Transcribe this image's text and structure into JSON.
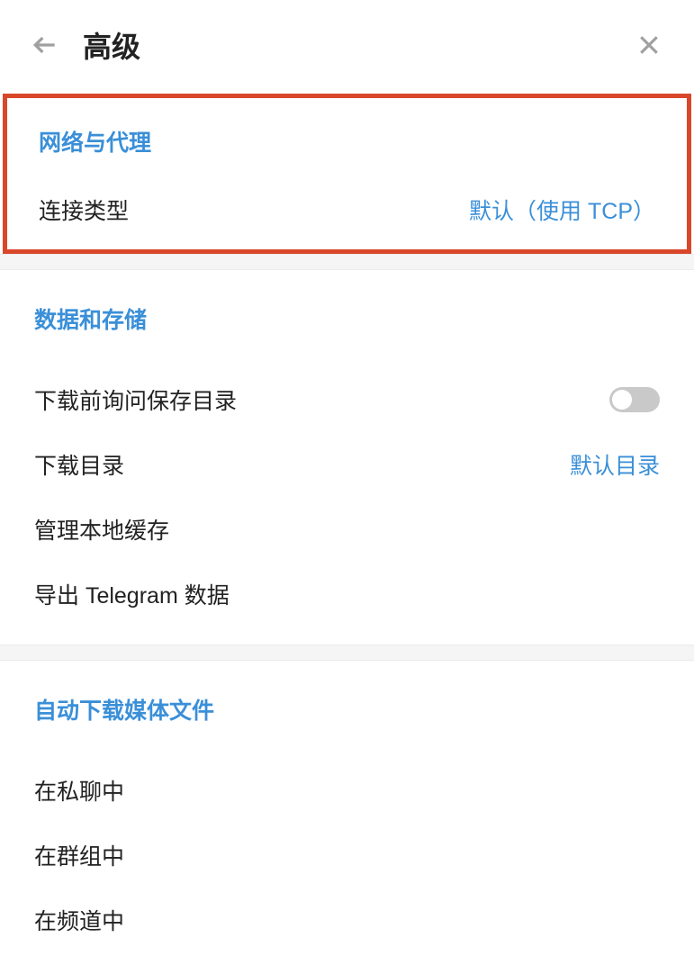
{
  "header": {
    "title": "高级"
  },
  "sections": {
    "network": {
      "title": "网络与代理",
      "connection_type": {
        "label": "连接类型",
        "value": "默认（使用 TCP）"
      }
    },
    "data_storage": {
      "title": "数据和存储",
      "ask_before_download": {
        "label": "下载前询问保存目录"
      },
      "download_dir": {
        "label": "下载目录",
        "value": "默认目录"
      },
      "manage_cache": {
        "label": "管理本地缓存"
      },
      "export_data": {
        "label": "导出 Telegram 数据"
      }
    },
    "auto_download": {
      "title": "自动下载媒体文件",
      "in_private": {
        "label": "在私聊中"
      },
      "in_groups": {
        "label": "在群组中"
      },
      "in_channels": {
        "label": "在频道中"
      }
    }
  }
}
